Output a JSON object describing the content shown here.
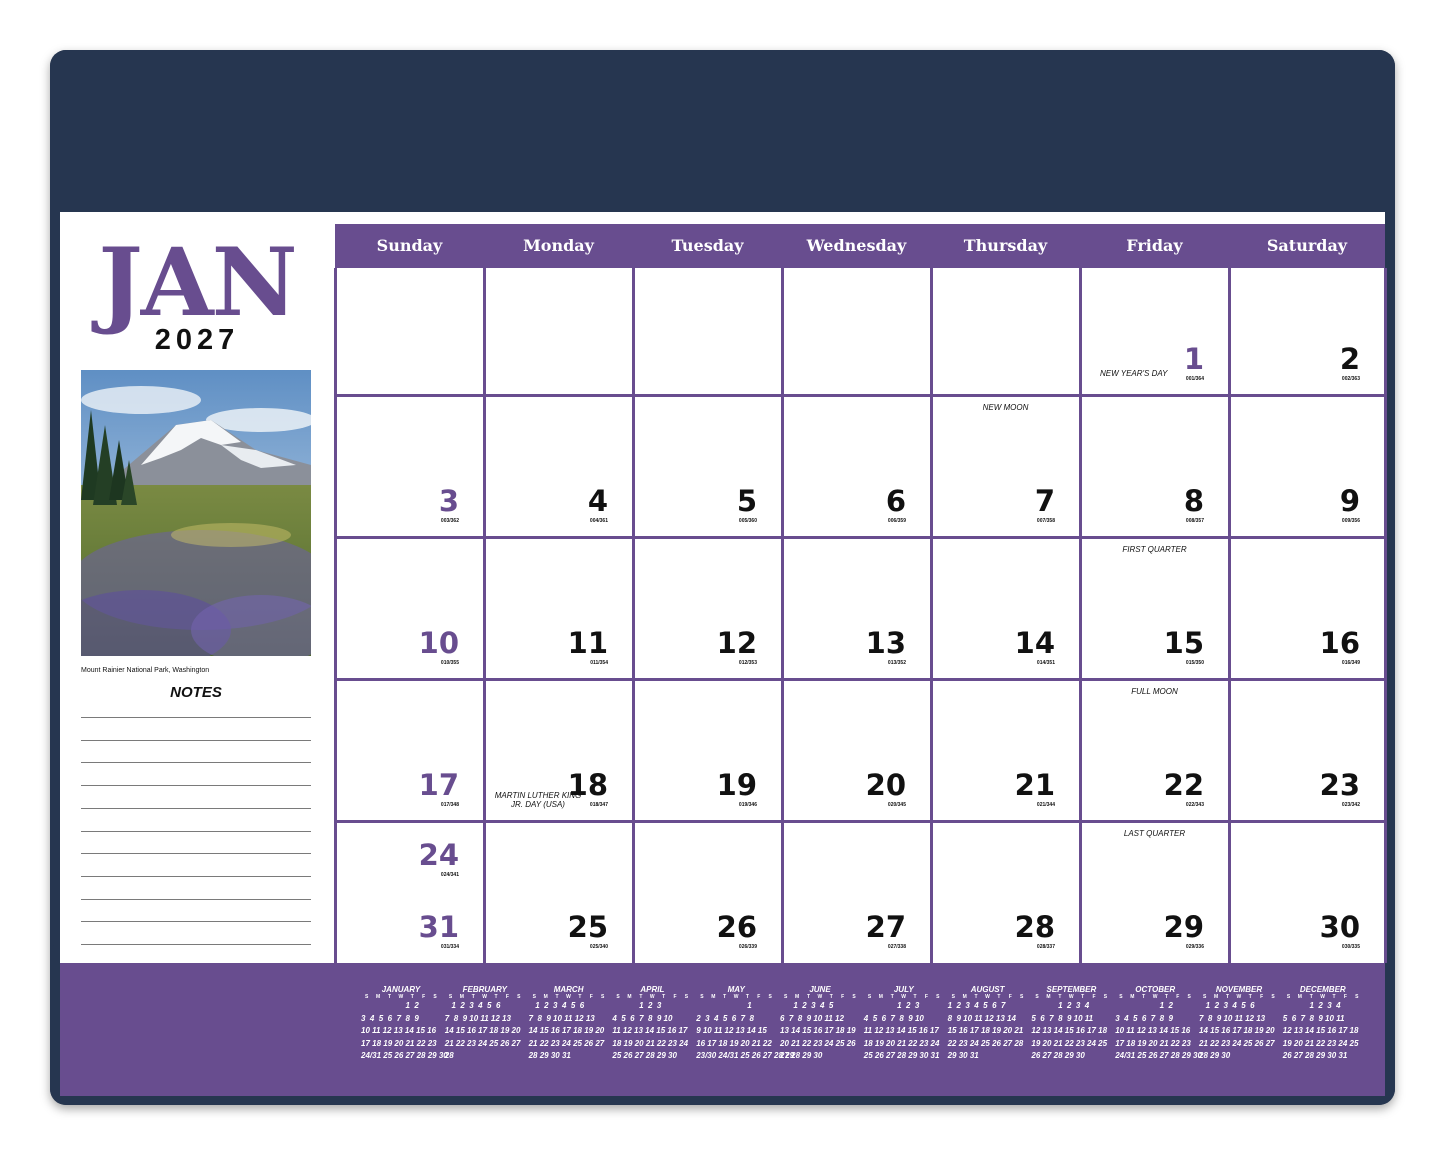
{
  "header": {
    "month": "JAN",
    "year": "2027"
  },
  "photo": {
    "caption": "Mount Rainier National Park, Washington"
  },
  "notes_label": "NOTES",
  "colors": {
    "accent": "#684d8f",
    "pad": "#263650"
  },
  "weekdays": [
    "Sunday",
    "Monday",
    "Tuesday",
    "Wednesday",
    "Thursday",
    "Friday",
    "Saturday"
  ],
  "days": [
    {
      "d": "1",
      "o": "001/364",
      "note": "NEW YEAR'S DAY"
    },
    {
      "d": "2",
      "o": "002/363"
    },
    {
      "d": "3",
      "o": "003/362"
    },
    {
      "d": "4",
      "o": "004/361"
    },
    {
      "d": "5",
      "o": "005/360"
    },
    {
      "d": "6",
      "o": "006/359"
    },
    {
      "d": "7",
      "o": "007/358",
      "note": "NEW MOON"
    },
    {
      "d": "8",
      "o": "008/357"
    },
    {
      "d": "9",
      "o": "009/356"
    },
    {
      "d": "10",
      "o": "010/355"
    },
    {
      "d": "11",
      "o": "011/354"
    },
    {
      "d": "12",
      "o": "012/353"
    },
    {
      "d": "13",
      "o": "013/352"
    },
    {
      "d": "14",
      "o": "014/351"
    },
    {
      "d": "15",
      "o": "015/350",
      "note": "FIRST QUARTER"
    },
    {
      "d": "16",
      "o": "016/349"
    },
    {
      "d": "17",
      "o": "017/348"
    },
    {
      "d": "18",
      "o": "018/347",
      "note": "MARTIN LUTHER KING JR. DAY (USA)"
    },
    {
      "d": "19",
      "o": "019/346"
    },
    {
      "d": "20",
      "o": "020/345"
    },
    {
      "d": "21",
      "o": "021/344"
    },
    {
      "d": "22",
      "o": "022/343",
      "note": "FULL MOON"
    },
    {
      "d": "23",
      "o": "023/342"
    },
    {
      "d": "24",
      "o": "024/341"
    },
    {
      "d": "25",
      "o": "025/340"
    },
    {
      "d": "26",
      "o": "026/339"
    },
    {
      "d": "27",
      "o": "027/338"
    },
    {
      "d": "28",
      "o": "028/337"
    },
    {
      "d": "29",
      "o": "029/336",
      "note": "LAST QUARTER"
    },
    {
      "d": "30",
      "o": "030/335"
    },
    {
      "d": "31",
      "o": "031/334"
    }
  ],
  "mini_dow": [
    "S",
    "M",
    "T",
    "W",
    "T",
    "F",
    "S"
  ],
  "mini_months": [
    {
      "name": "JANUARY",
      "rows": [
        "                    1  2",
        "3  4  5  6  7  8  9",
        "10 11 12 13 14 15 16",
        "17 18 19 20 21 22 23",
        "24/31 25 26 27 28 29 30"
      ]
    },
    {
      "name": "FEBRUARY",
      "rows": [
        "   1  2  3  4  5  6",
        "7  8  9 10 11 12 13",
        "14 15 16 17 18 19 20",
        "21 22 23 24 25 26 27",
        "28"
      ]
    },
    {
      "name": "MARCH",
      "rows": [
        "   1  2  3  4  5  6",
        "7  8  9 10 11 12 13",
        "14 15 16 17 18 19 20",
        "21 22 23 24 25 26 27",
        "28 29 30 31"
      ]
    },
    {
      "name": "APRIL",
      "rows": [
        "            1  2  3",
        "4  5  6  7  8  9 10",
        "11 12 13 14 15 16 17",
        "18 19 20 21 22 23 24",
        "25 26 27 28 29 30"
      ]
    },
    {
      "name": "MAY",
      "rows": [
        "                       1",
        "2  3  4  5  6  7  8",
        "9 10 11 12 13 14 15",
        "16 17 18 19 20 21 22",
        "23/30 24/31 25 26 27 28 29"
      ]
    },
    {
      "name": "JUNE",
      "rows": [
        "      1  2  3  4  5",
        "6  7  8  9 10 11 12",
        "13 14 15 16 17 18 19",
        "20 21 22 23 24 25 26",
        "27 28 29 30"
      ]
    },
    {
      "name": "JULY",
      "rows": [
        "               1  2  3",
        "4  5  6  7  8  9 10",
        "11 12 13 14 15 16 17",
        "18 19 20 21 22 23 24",
        "25 26 27 28 29 30 31"
      ]
    },
    {
      "name": "AUGUST",
      "rows": [
        "1  2  3  4  5  6  7",
        "8  9 10 11 12 13 14",
        "15 16 17 18 19 20 21",
        "22 23 24 25 26 27 28",
        "29 30 31"
      ]
    },
    {
      "name": "SEPTEMBER",
      "rows": [
        "            1  2  3  4",
        "5  6  7  8  9 10 11",
        "12 13 14 15 16 17 18",
        "19 20 21 22 23 24 25",
        "26 27 28 29 30"
      ]
    },
    {
      "name": "OCTOBER",
      "rows": [
        "                    1  2",
        "3  4  5  6  7  8  9",
        "10 11 12 13 14 15 16",
        "17 18 19 20 21 22 23",
        "24/31 25 26 27 28 29 30"
      ]
    },
    {
      "name": "NOVEMBER",
      "rows": [
        "   1  2  3  4  5  6",
        "7  8  9 10 11 12 13",
        "14 15 16 17 18 19 20",
        "21 22 23 24 25 26 27",
        "28 29 30"
      ]
    },
    {
      "name": "DECEMBER",
      "rows": [
        "            1  2  3  4",
        "5  6  7  8  9 10 11",
        "12 13 14 15 16 17 18",
        "19 20 21 22 23 24 25",
        "26 27 28 29 30 31"
      ]
    }
  ]
}
